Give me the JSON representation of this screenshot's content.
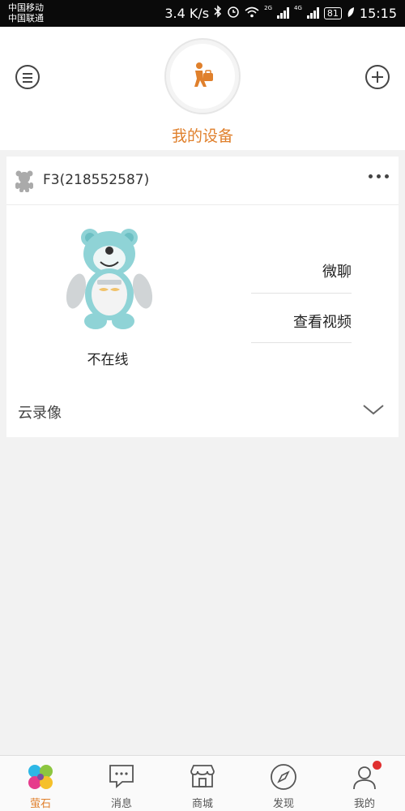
{
  "status_bar": {
    "carrier1": "中国移动",
    "carrier2": "中国联通",
    "speed": "3.4 K/s",
    "net1": "2G",
    "net2": "4G",
    "battery": "81",
    "time": "15:15"
  },
  "header": {
    "title": "我的设备"
  },
  "device": {
    "name": "F3(218552587)",
    "status": "不在线",
    "actions": [
      "微聊",
      "查看视频"
    ],
    "cloud_label": "云录像"
  },
  "tabs": [
    {
      "label": "萤石",
      "icon": "ezviz-logo-icon",
      "active": true
    },
    {
      "label": "消息",
      "icon": "message-icon",
      "active": false
    },
    {
      "label": "商城",
      "icon": "store-icon",
      "active": false
    },
    {
      "label": "发现",
      "icon": "compass-icon",
      "active": false
    },
    {
      "label": "我的",
      "icon": "user-icon",
      "active": false
    }
  ],
  "colors": {
    "accent": "#e0802c",
    "badge": "#e03030",
    "robot": "#8fd3d6"
  }
}
